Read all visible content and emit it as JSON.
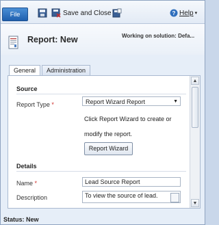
{
  "ribbon": {
    "file_label": "File",
    "save_close_label": "Save and Close",
    "help_label": "Help",
    "help_caret": "▾"
  },
  "header": {
    "title": "Report: New",
    "working_on": "Working on solution: Defa..."
  },
  "tabs": [
    {
      "label": "General",
      "active": true
    },
    {
      "label": "Administration",
      "active": false
    }
  ],
  "source": {
    "title": "Source",
    "report_type_label": "Report Type",
    "required_mark": "*",
    "report_type_value": "Report Wizard Report",
    "hint_line1": "Click Report Wizard to create or",
    "hint_line2": "modify the report.",
    "wizard_button_label": "Report Wizard"
  },
  "details": {
    "title": "Details",
    "name_label": "Name",
    "required_mark": "*",
    "name_value": "Lead Source Report",
    "description_label": "Description",
    "description_value": "To view the source of lead."
  },
  "status": {
    "text": "Status: New"
  }
}
